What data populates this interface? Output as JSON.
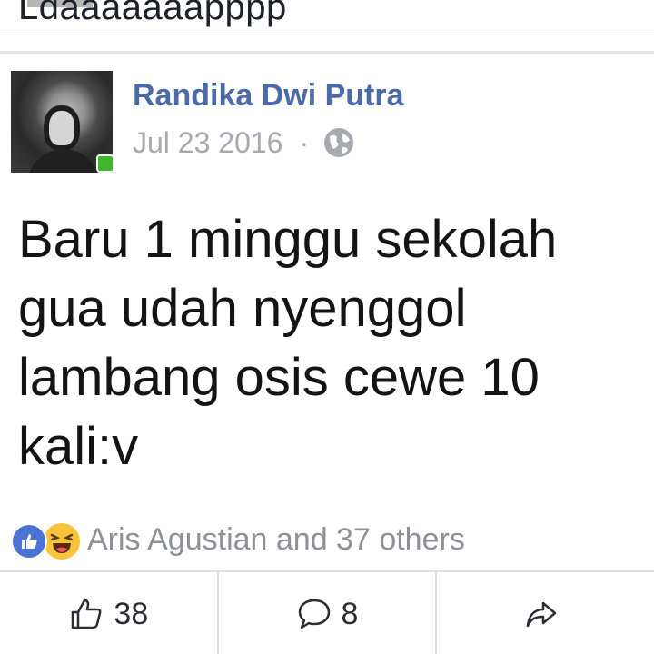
{
  "previous_post": {
    "cut_text": "Ldaaaaaaapppp"
  },
  "post": {
    "author": "Randika Dwi Putra",
    "date": "Jul 23 2016",
    "separator": "·",
    "privacy_icon": "globe-icon",
    "online_status": "online",
    "text": "Baru 1 minggu sekolah\ngua udah nyenggol\nlambang osis cewe 10\nkali:v"
  },
  "reactions": {
    "icons": [
      "like-icon",
      "haha-icon"
    ],
    "summary": "Aris Agustian and 37 others"
  },
  "actions": {
    "like_count": "38",
    "comment_count": "8",
    "like_icon": "thumbs-up-icon",
    "comment_icon": "comment-icon",
    "share_icon": "share-icon"
  },
  "colors": {
    "author_name": "#4b6aa8",
    "meta_text": "#a6a9b0",
    "like_blue": "#4c74d6",
    "haha_yellow": "#f7c43a",
    "online_green": "#42b72a"
  }
}
